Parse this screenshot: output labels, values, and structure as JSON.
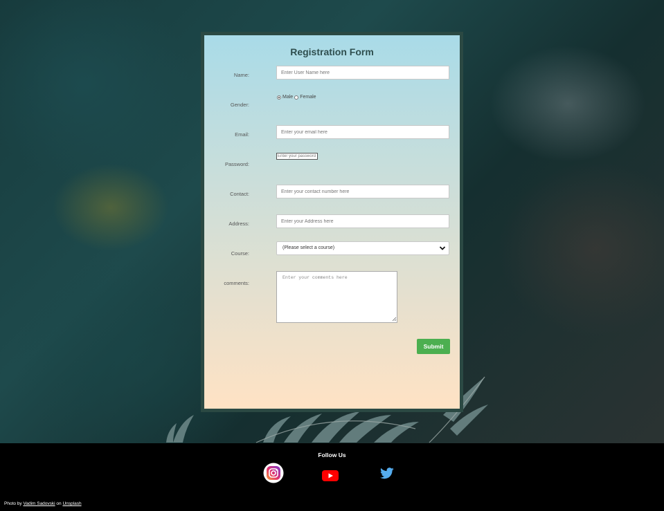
{
  "form": {
    "title": "Registration Form",
    "name_label": "Name:",
    "name_placeholder": "Enter User Name here",
    "gender_label": "Gender:",
    "gender_options": [
      {
        "label": "Male",
        "checked": true
      },
      {
        "label": "Female",
        "checked": false
      }
    ],
    "email_label": "Email:",
    "email_placeholder": "Enter your email here",
    "password_label": "Password:",
    "password_placeholder": "Enter your password",
    "contact_label": "Contact:",
    "contact_placeholder": "Enter your contact number here",
    "address_label": "Address:",
    "address_placeholder": "Enter your Address here",
    "course_label": "Course:",
    "course_selected": "(Please select a course)",
    "comments_label": "comments:",
    "comments_placeholder": "Enter your comments here",
    "submit_label": "Submit"
  },
  "footer": {
    "follow_label": "Follow Us",
    "socials": [
      {
        "name": "instagram-icon"
      },
      {
        "name": "youtube-icon"
      },
      {
        "name": "twitter-icon"
      }
    ],
    "credit": {
      "prefix": "Photo by",
      "author": "Vadim Sadovski",
      "middle": "on",
      "site": "Unsplash"
    }
  },
  "colors": {
    "card_border": "#2b4943",
    "submit_bg": "#4caf50",
    "footer_bg": "#000000",
    "title": "#2f4f4f"
  }
}
